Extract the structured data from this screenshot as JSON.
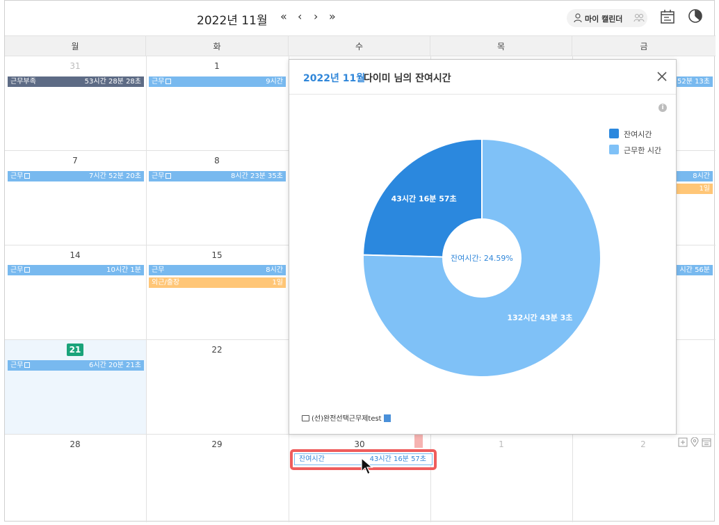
{
  "header": {
    "title": "2022년 11월",
    "nav_first": "«",
    "nav_prev": "‹",
    "nav_next": "›",
    "nav_last": "»",
    "my_calendar": "마이 캘린더"
  },
  "weekdays": [
    "월",
    "화",
    "수",
    "목",
    "금"
  ],
  "days": {
    "r0": [
      "31",
      "1"
    ],
    "r1": [
      "7",
      "8"
    ],
    "r2": [
      "14",
      "15"
    ],
    "r3": [
      "21",
      "22"
    ],
    "r4": [
      "28",
      "29",
      "30",
      "1",
      "2"
    ]
  },
  "events": {
    "e1": {
      "label": "근무부족",
      "value": "53시간 28분 28초"
    },
    "e2": {
      "label": "근무",
      "value": "9시간"
    },
    "e3": {
      "label": "근무",
      "value": "7시간 52분 20초"
    },
    "e4": {
      "label": "근무",
      "value": "8시간 23분 35초"
    },
    "e5": {
      "label": "근무",
      "value": "10시간 1분"
    },
    "e6": {
      "label": "근무",
      "value": "8시간"
    },
    "e7": {
      "label": "외근/출장",
      "value": "1일"
    },
    "e8": {
      "label": "근무",
      "value": "6시간 20분 21초"
    },
    "e9": {
      "label": "잔여시간",
      "value": "43시간 16분 57초"
    },
    "fri1": "52분 13초",
    "fri2": "8시간",
    "fri3": "1일",
    "fri4": "시간 56분"
  },
  "popup": {
    "title_date": "2022년 11월",
    "title_name": "다이미 님의 잔여시간",
    "info": "i",
    "legend": [
      {
        "label": "잔여시간",
        "color": "#2b88de"
      },
      {
        "label": "근무한 시간",
        "color": "#7fc1f7"
      }
    ],
    "center_label": "잔여시간: 24.59%",
    "footer": "(선)완전선택근무제test"
  },
  "chart_data": {
    "type": "pie",
    "donut": true,
    "slices": [
      {
        "label": "잔여시간",
        "value_text": "43시간 16분 57초",
        "value_hours": 43.28,
        "percent": 24.59,
        "color": "#2b88de"
      },
      {
        "label": "근무한 시간",
        "value_text": "132시간 43분 3초",
        "value_hours": 132.72,
        "percent": 75.41,
        "color": "#7fc1f7"
      }
    ],
    "legend_position": "top-right"
  }
}
